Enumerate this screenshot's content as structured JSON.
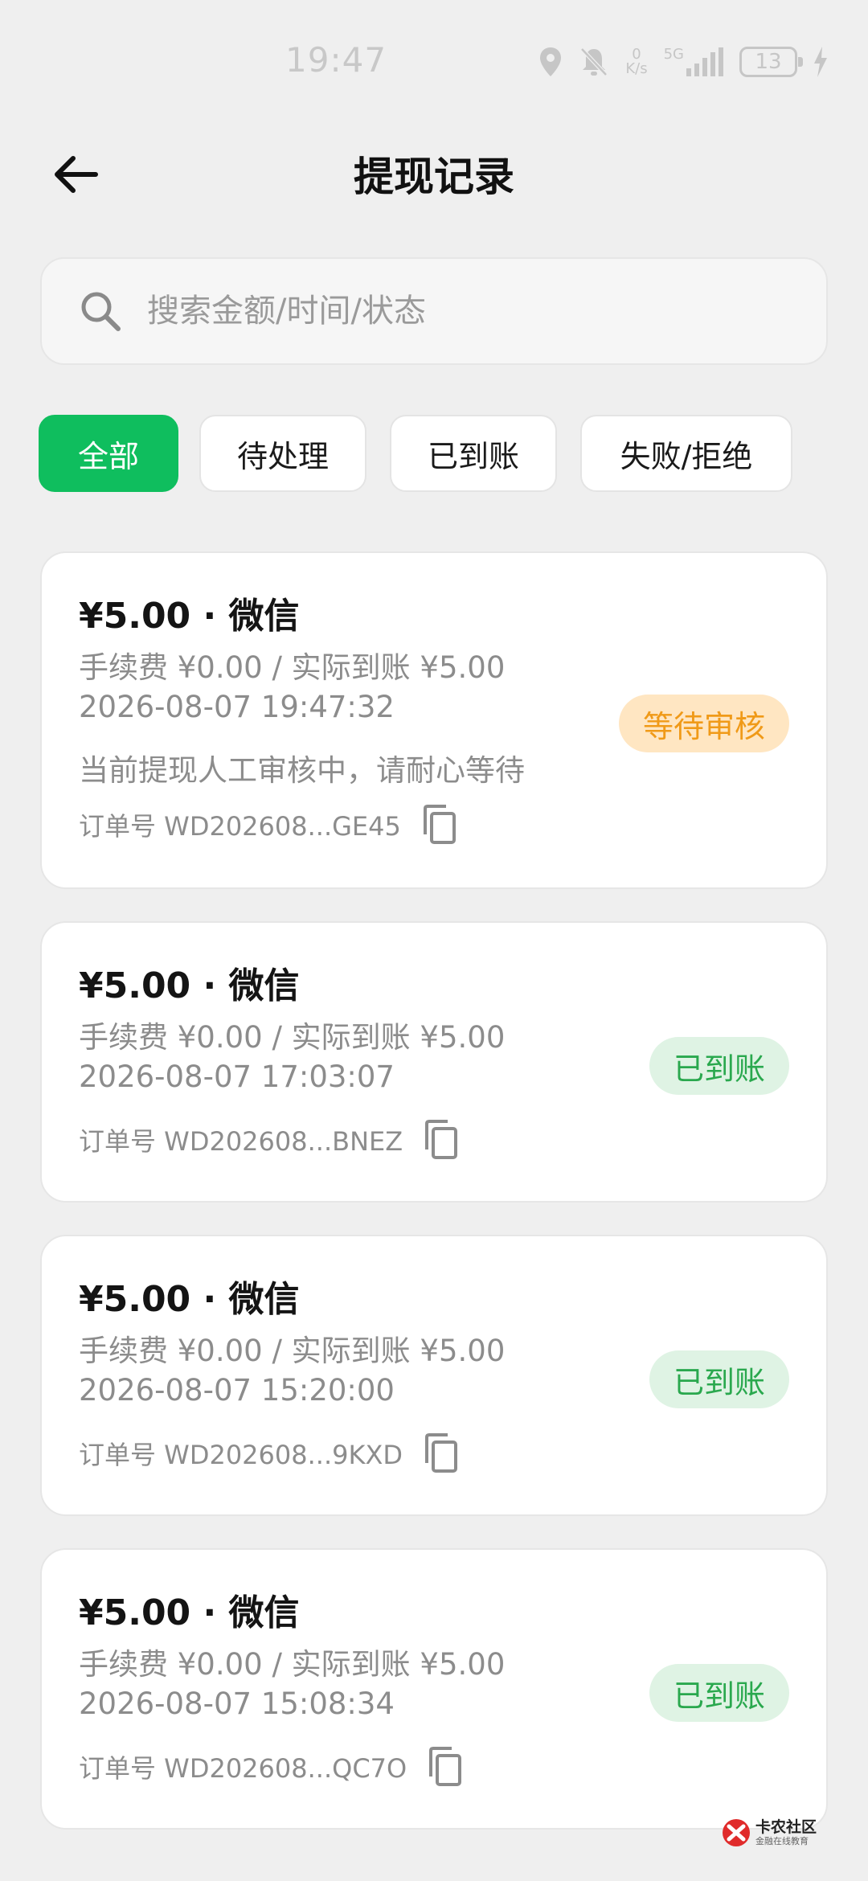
{
  "status_bar": {
    "time": "19:47",
    "speed_value": "0",
    "speed_unit": "K/s",
    "network": "5G",
    "battery": "13"
  },
  "header": {
    "title": "提现记录"
  },
  "search": {
    "placeholder": "搜索金额/时间/状态"
  },
  "tabs": [
    {
      "label": "全部",
      "active": true
    },
    {
      "label": "待处理",
      "active": false
    },
    {
      "label": "已到账",
      "active": false
    },
    {
      "label": "失败/拒绝",
      "active": false
    }
  ],
  "records": [
    {
      "amount_line": "¥5.00 · 微信",
      "fee_line": "手续费 ¥0.00 / 实际到账 ¥5.00",
      "time": "2026-08-07 19:47:32",
      "note": "当前提现人工审核中，请耐心等待",
      "order": "订单号 WD202608...GE45",
      "status": "等待审核",
      "status_type": "pending"
    },
    {
      "amount_line": "¥5.00 · 微信",
      "fee_line": "手续费 ¥0.00 / 实际到账 ¥5.00",
      "time": "2026-08-07 17:03:07",
      "order": "订单号 WD202608...BNEZ",
      "status": "已到账",
      "status_type": "done"
    },
    {
      "amount_line": "¥5.00 · 微信",
      "fee_line": "手续费 ¥0.00 / 实际到账 ¥5.00",
      "time": "2026-08-07 15:20:00",
      "order": "订单号 WD202608...9KXD",
      "status": "已到账",
      "status_type": "done"
    },
    {
      "amount_line": "¥5.00 · 微信",
      "fee_line": "手续费 ¥0.00 / 实际到账 ¥5.00",
      "time": "2026-08-07 15:08:34",
      "order": "订单号 WD202608...QC7O",
      "status": "已到账",
      "status_type": "done"
    }
  ],
  "watermark": {
    "main": "卡农社区",
    "sub": "金融在线教育"
  },
  "colors": {
    "accent": "#0fbe5e",
    "pending_bg": "#ffe6c2",
    "pending_text": "#f09a18",
    "done_bg": "#dff3e4",
    "done_text": "#2aa84e"
  }
}
